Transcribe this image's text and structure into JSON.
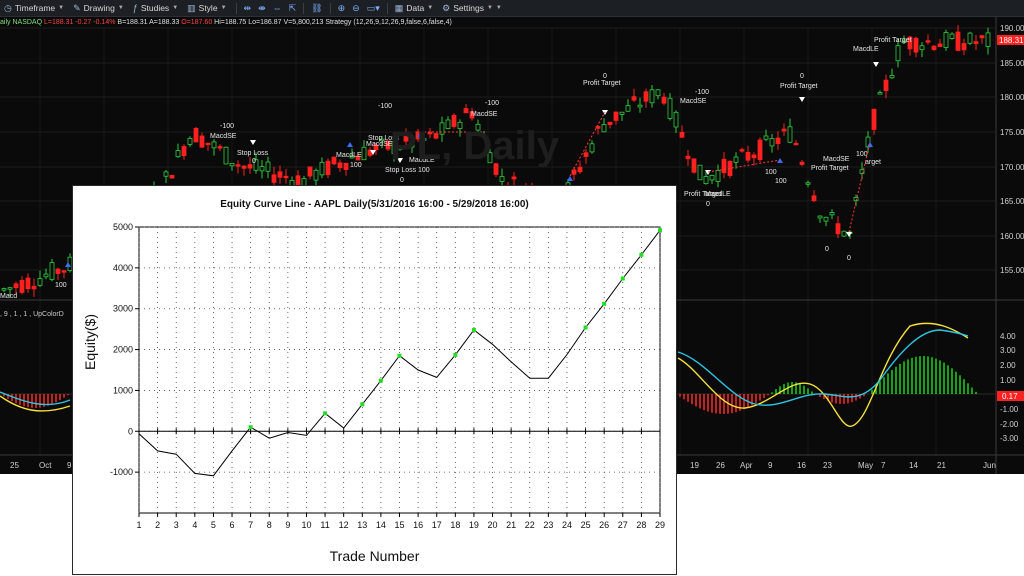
{
  "toolbar": {
    "items": [
      {
        "label": "Timeframe",
        "icon": "clock-icon",
        "glyph": "◷"
      },
      {
        "label": "Drawing",
        "icon": "pencil-icon",
        "glyph": "✎"
      },
      {
        "label": "Studies",
        "icon": "studies-icon",
        "glyph": "ƒ"
      },
      {
        "label": "Style",
        "icon": "style-icon",
        "glyph": "▥"
      }
    ],
    "data_label": "Data",
    "settings_label": "Settings"
  },
  "infobar": {
    "symbol": "aily",
    "exchange": "NASDAQ",
    "last": "L=188.31",
    "change": "-0.27",
    "pct": "-0.14%",
    "bid": "B=188.31",
    "ask": "A=188.33",
    "open": "O=187.60",
    "high": "Hi=188.75",
    "low": "Lo=186.87",
    "volume": "V=5,800,213",
    "strategy": "Strategy (12,26,9,12,26,9,false,6,false,4)"
  },
  "indicator_label": ", 9 , 1 , 1 , UpColorD",
  "watermark": "PL, Daily",
  "price_axis": {
    "ticks": [
      "190.00",
      "185.00",
      "180.00",
      "175.00",
      "170.00",
      "165.00",
      "160.00",
      "155.00"
    ],
    "last_price": "188.31"
  },
  "macd_axis": {
    "ticks": [
      "4.00",
      "3.00",
      "2.00",
      "1.00",
      "0.00",
      "-1.00",
      "-2.00",
      "-3.00"
    ],
    "last_value": "0.17"
  },
  "date_axis": [
    "25",
    "Oct",
    "9",
    "19",
    "26",
    "Apr",
    "9",
    "16",
    "23",
    "May",
    "7",
    "14",
    "21",
    "Jun"
  ],
  "annotations": [
    {
      "text": "-100",
      "kind": "qty"
    },
    {
      "text": "MacdSE",
      "kind": "label"
    },
    {
      "text": "Stop Loss",
      "kind": "label"
    },
    {
      "text": "0",
      "kind": "qty"
    },
    {
      "text": "MacdLE",
      "kind": "label"
    },
    {
      "text": "100",
      "kind": "qty"
    },
    {
      "text": "-100",
      "kind": "qty"
    },
    {
      "text": "Stop Loss",
      "kind": "label"
    },
    {
      "text": "MacdSE",
      "kind": "label"
    },
    {
      "text": "Stop Loss",
      "kind": "label"
    },
    {
      "text": "0",
      "kind": "qty"
    },
    {
      "text": "MacdLE",
      "kind": "label"
    },
    {
      "text": "100",
      "kind": "qty"
    },
    {
      "text": "-100",
      "kind": "qty"
    },
    {
      "text": "MacdSE",
      "kind": "label"
    },
    {
      "text": "0",
      "kind": "qty"
    },
    {
      "text": "Profit Target",
      "kind": "label"
    },
    {
      "text": "-100",
      "kind": "qty"
    },
    {
      "text": "MacdSE",
      "kind": "label"
    },
    {
      "text": "Profit Target",
      "kind": "label"
    },
    {
      "text": "0",
      "kind": "qty"
    },
    {
      "text": "0",
      "kind": "qty"
    },
    {
      "text": "Profit Target",
      "kind": "label"
    },
    {
      "text": "MacdLE",
      "kind": "label"
    },
    {
      "text": "100",
      "kind": "qty"
    },
    {
      "text": "100",
      "kind": "qty"
    },
    {
      "text": "MacdSE",
      "kind": "label"
    },
    {
      "text": "Profit Target",
      "kind": "label"
    },
    {
      "text": "0",
      "kind": "qty"
    },
    {
      "text": "0",
      "kind": "qty"
    },
    {
      "text": "Profit Target",
      "kind": "label"
    },
    {
      "text": "MacdLE",
      "kind": "label"
    },
    {
      "text": "100",
      "kind": "qty"
    },
    {
      "text": "arget",
      "kind": "label"
    },
    {
      "text": "Macd",
      "kind": "label"
    },
    {
      "text": "100",
      "kind": "qty"
    }
  ],
  "colors": {
    "up": "#2ecc40",
    "down": "#ff2020",
    "macd_line": "#f5e13a",
    "signal_line": "#2ec4e0",
    "hist_pos": "#19d419",
    "hist_neg": "#ff2a2a",
    "equity_point": "#22dd22"
  },
  "chart_data": {
    "type": "line",
    "title": "Equity Curve Line - AAPL Daily(5/31/2016 16:00 - 5/29/2018 16:00)",
    "xlabel": "Trade Number",
    "ylabel": "Equity($)",
    "x": [
      1,
      2,
      3,
      4,
      5,
      6,
      7,
      8,
      9,
      10,
      11,
      12,
      13,
      14,
      15,
      16,
      17,
      18,
      19,
      20,
      21,
      22,
      23,
      24,
      25,
      26,
      27,
      28,
      29
    ],
    "series": [
      {
        "values": [
          -60,
          -480,
          -560,
          -1030,
          -1090,
          -480,
          100,
          -170,
          -30,
          -100,
          440,
          80,
          660,
          1240,
          1850,
          1500,
          1320,
          1870,
          2480,
          2130,
          1700,
          1300,
          1300,
          1880,
          2540,
          3120,
          3740,
          4320,
          4920
        ]
      }
    ],
    "marked_points": [
      7,
      11,
      13,
      14,
      15,
      18,
      19,
      25,
      26,
      27,
      28,
      29
    ],
    "xlim": [
      1,
      29
    ],
    "ylim": [
      -2000,
      5000
    ],
    "yticks": [
      -1000,
      0,
      1000,
      2000,
      3000,
      4000,
      5000
    ],
    "grid": true
  }
}
